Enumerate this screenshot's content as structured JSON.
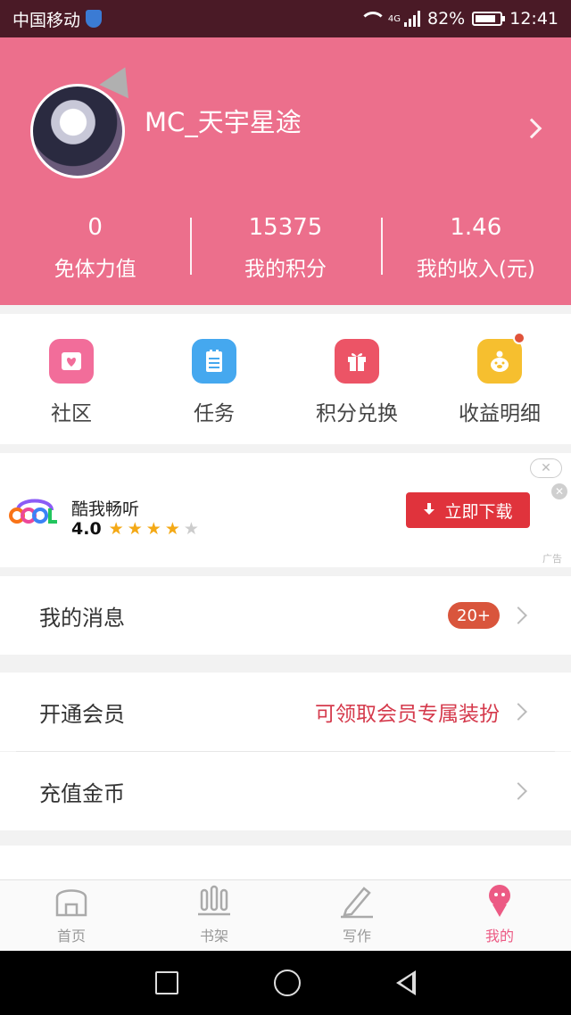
{
  "status_bar": {
    "carrier": "中国移动",
    "network": "4G",
    "battery": "82%",
    "battery_level": 0.82,
    "time": "12:41"
  },
  "profile": {
    "username": "MC_天宇星途"
  },
  "stats": [
    {
      "value": "0",
      "label": "免体力值"
    },
    {
      "value": "15375",
      "label": "我的积分"
    },
    {
      "value": "1.46",
      "label": "我的收入(元)"
    }
  ],
  "shortcuts": [
    {
      "label": "社区",
      "icon": "heart-envelope-icon",
      "color": "#f26d9a"
    },
    {
      "label": "任务",
      "icon": "clipboard-icon",
      "color": "#45a8ef"
    },
    {
      "label": "积分兑换",
      "icon": "gift-icon",
      "color": "#ec5466"
    },
    {
      "label": "收益明细",
      "icon": "piggy-icon",
      "color": "#f6bf2f"
    }
  ],
  "ad": {
    "app_name": "酷我畅听",
    "rating": "4.0",
    "stars": 4,
    "button": "立即下载",
    "tag": "广告"
  },
  "menu": {
    "messages": {
      "label": "我的消息",
      "badge": "20+"
    },
    "vip": {
      "label": "开通会员",
      "promo": "可领取会员专属装扮"
    },
    "recharge": {
      "label": "充值金币"
    }
  },
  "tabs": [
    {
      "label": "首页",
      "icon": "home-icon"
    },
    {
      "label": "书架",
      "icon": "bookshelf-icon"
    },
    {
      "label": "写作",
      "icon": "pencil-icon"
    },
    {
      "label": "我的",
      "icon": "profile-icon",
      "active": true
    }
  ]
}
